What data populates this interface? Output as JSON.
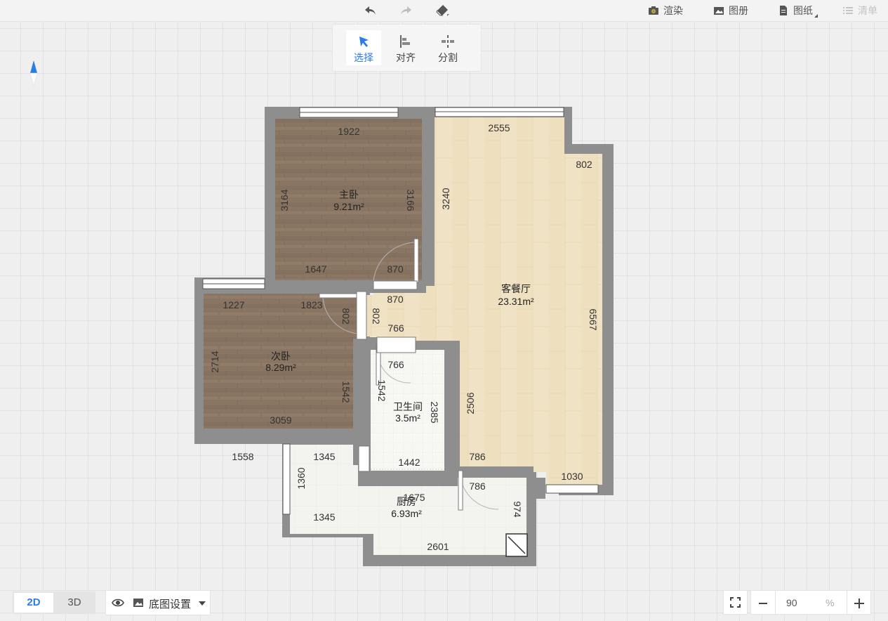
{
  "toolbar": {
    "undo_icon": "undo-icon",
    "redo_icon": "redo-icon",
    "eraser_icon": "eraser-icon",
    "render_label": "渲染",
    "album_label": "图册",
    "drawing_label": "图纸",
    "list_label": "清单"
  },
  "tools": {
    "select_label": "选择",
    "align_label": "对齐",
    "split_label": "分割"
  },
  "rooms": {
    "master": {
      "name": "主卧",
      "area": "9.21m²"
    },
    "living": {
      "name": "客餐厅",
      "area": "23.31m²"
    },
    "second": {
      "name": "次卧",
      "area": "8.29m²"
    },
    "bath": {
      "name": "卫生间",
      "area": "3.5m²"
    },
    "kitchen": {
      "name": "厨房",
      "area": "6.93m²"
    }
  },
  "dims": {
    "d1922": "1922",
    "d2555": "2555",
    "d802a": "802",
    "d3164": "3164",
    "d3166": "3166",
    "d3240": "3240",
    "d1647": "1647",
    "d870a": "870",
    "d870b": "870",
    "d6567": "6567",
    "d1227": "1227",
    "d1823": "1823",
    "d802b": "802",
    "d802c": "802",
    "d766a": "766",
    "d766b": "766",
    "d2714": "2714",
    "d1542a": "1542",
    "d1542b": "1542",
    "d2385": "2385",
    "d2506": "2506",
    "d3059": "3059",
    "d1558": "1558",
    "d1345a": "1345",
    "d1442": "1442",
    "d786a": "786",
    "d786b": "786",
    "d1030": "1030",
    "d1360": "1360",
    "d1675": "1675",
    "d974": "974",
    "d1345b": "1345",
    "d2601": "2601"
  },
  "bottom": {
    "mode_2d": "2D",
    "mode_3d": "3D",
    "bg_settings_label": "底图设置",
    "zoom_value": "90",
    "zoom_unit": "%"
  },
  "colors": {
    "accent": "#2b7ce9",
    "wall": "#8e8e8e",
    "wood": "#8a7663",
    "living_floor": "#f0e2c4",
    "tile": "#f4f4f0"
  }
}
